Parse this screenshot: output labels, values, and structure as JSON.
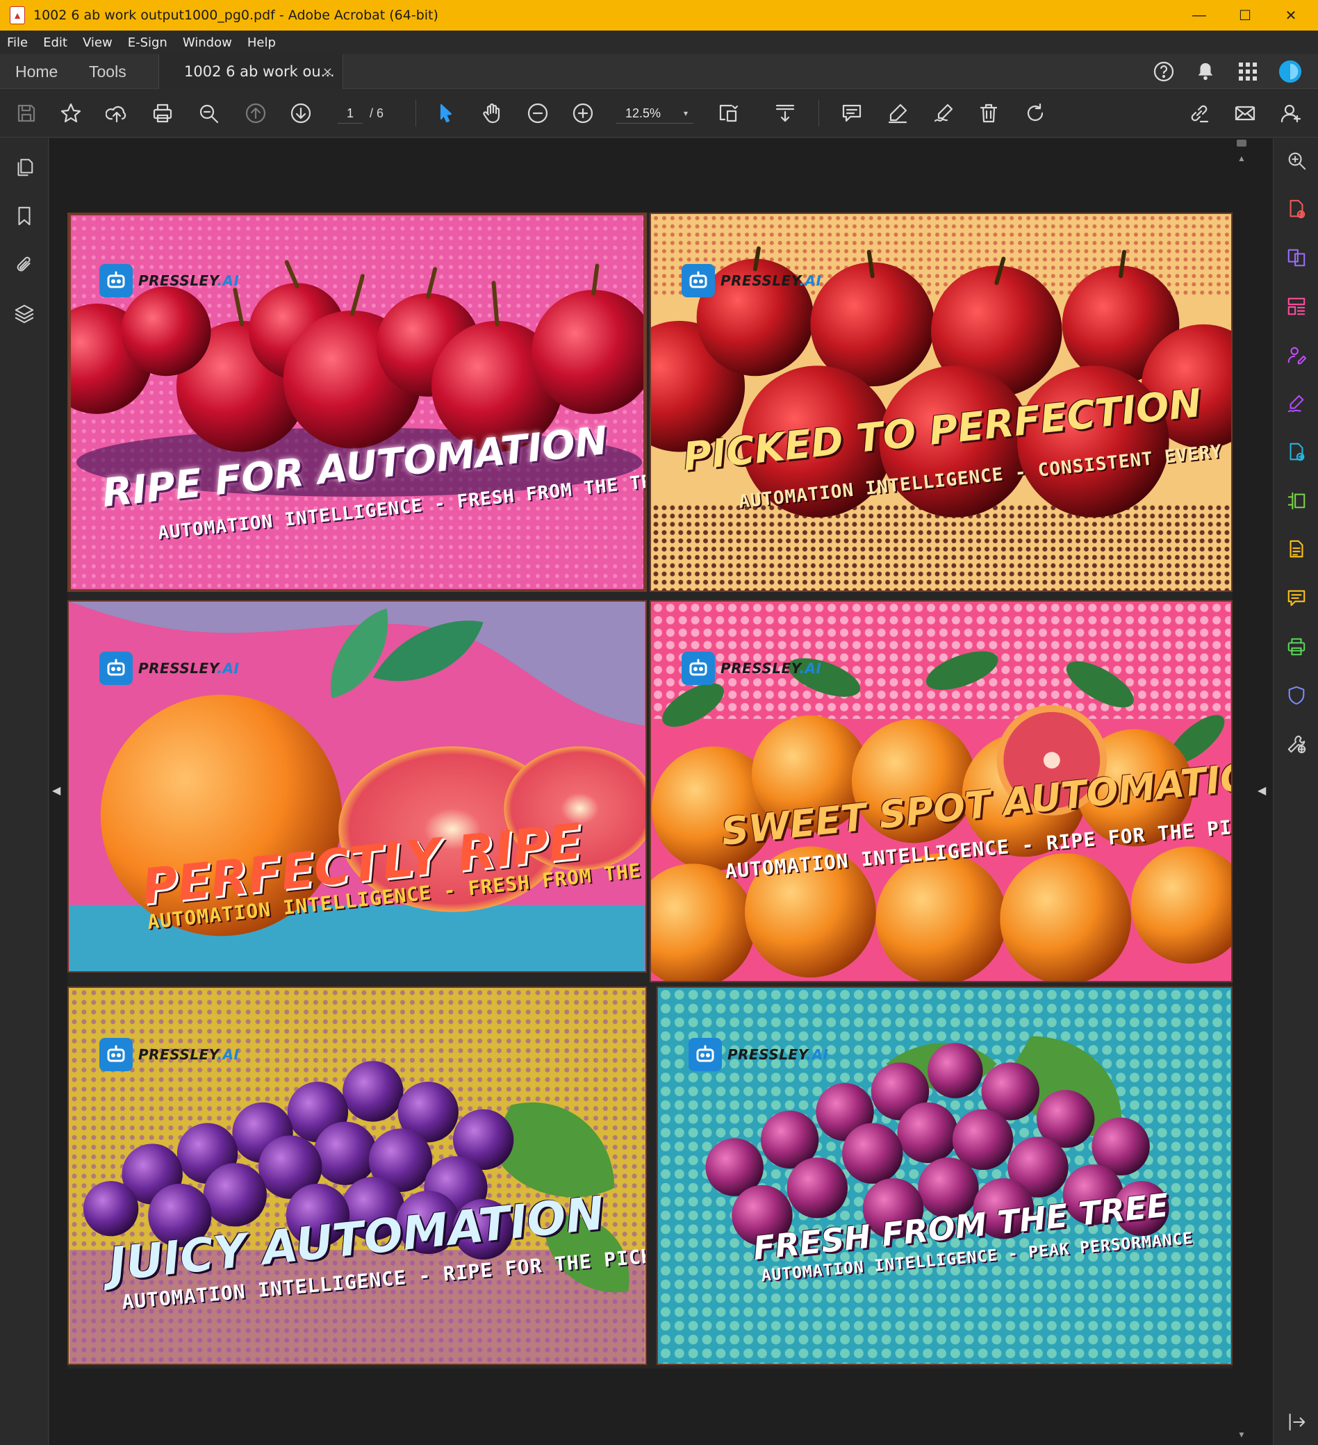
{
  "window": {
    "title": "1002  6 ab work output1000_pg0.pdf - Adobe Acrobat (64-bit)",
    "controls": [
      "—",
      "☐",
      "✕"
    ]
  },
  "menu": [
    "File",
    "Edit",
    "View",
    "E-Sign",
    "Window",
    "Help"
  ],
  "tabs": {
    "home": "Home",
    "tools": "Tools",
    "document": "1002  6 ab work ou...",
    "close": "×"
  },
  "toolbar": {
    "page_current": "1",
    "page_total": "/ 6",
    "zoom": "12.5%",
    "zoom_caret": "▾"
  },
  "icons": {
    "top_right": [
      "help-icon",
      "bell-icon",
      "apps-grid-icon",
      "profile-avatar-icon"
    ],
    "toolbar": [
      "save-icon",
      "star-icon",
      "upload-cloud-icon",
      "print-icon",
      "zoom-search-icon",
      "page-up-icon",
      "page-down-icon",
      "select-arrow-icon",
      "hand-icon",
      "zoom-out-icon",
      "zoom-in-icon",
      "fit-page-icon",
      "scroll-mode-icon",
      "comment-icon",
      "highlight-pen-icon",
      "sign-icon",
      "delete-icon",
      "rotate-icon",
      "share-link-icon",
      "email-icon",
      "add-user-icon"
    ],
    "left_rail": [
      "pages-icon",
      "bookmark-icon",
      "attachment-icon",
      "layers-icon"
    ],
    "right_rail": [
      "zoom-search-icon",
      "create-pdf-icon",
      "combine-files-icon",
      "organize-pages-icon",
      "request-signature-icon",
      "fill-sign-icon",
      "export-pdf-icon",
      "edit-pdf-icon",
      "scan-ocr-icon",
      "comment-icon",
      "print-production-icon",
      "protect-icon",
      "more-tools-icon",
      "exit-panel-icon"
    ]
  },
  "colors": {
    "titlebar": "#f7b500",
    "accent_blue": "#1e86d8",
    "purple_tool": "#b44cff"
  },
  "banners": [
    {
      "brand": "PRESSLEY",
      "brand_ai": ".AI",
      "headline": "RIPE FOR AUTOMATION",
      "tagline": "AUTOMATION INTELLIGENCE - FRESH FROM THE TREE",
      "fruit": "apples"
    },
    {
      "brand": "PRESSLEY",
      "brand_ai": ".AI",
      "headline": "PICKED TO PERFECTION",
      "tagline": "AUTOMATION INTELLIGENCE - CONSISTENT EVERY TIME",
      "fruit": "apples"
    },
    {
      "brand": "PRESSLEY",
      "brand_ai": ".AI",
      "headline": "PERFECTLY RIPE",
      "tagline": "AUTOMATION INTELLIGENCE - FRESH FROM THE TREE",
      "fruit": "grapefruit"
    },
    {
      "brand": "PRESSLEY",
      "brand_ai": ".AI",
      "headline": "SWEET SPOT AUTOMATION",
      "tagline": "AUTOMATION INTELLIGENCE - RIPE FOR THE PICKIN'",
      "fruit": "oranges"
    },
    {
      "brand": "PRESSLEY",
      "brand_ai": ".AI",
      "headline": "JUICY AUTOMATION",
      "tagline": "AUTOMATION INTELLIGENCE - RIPE FOR THE PICKIN'",
      "fruit": "grapes"
    },
    {
      "brand": "PRESSLEY",
      "brand_ai": ".AI",
      "headline": "FRESH FROM THE TREE",
      "tagline": "AUTOMATION INTELLIGENCE - PEAK PERSORMANCE",
      "fruit": "grapes"
    }
  ]
}
